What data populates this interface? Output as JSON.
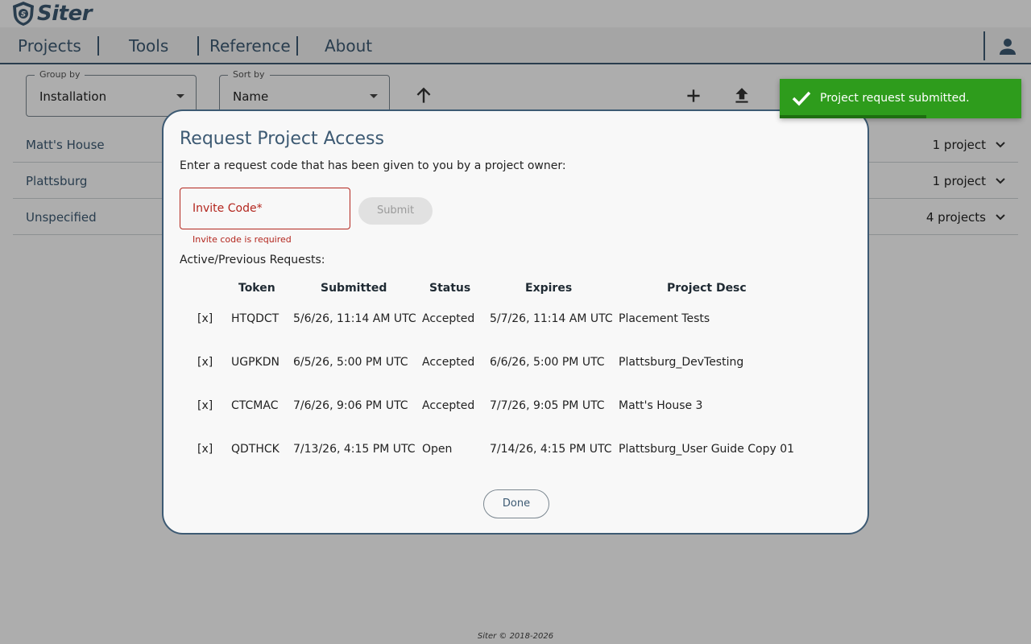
{
  "app": {
    "name": "Siter"
  },
  "nav": {
    "items": [
      {
        "label": "Projects"
      },
      {
        "label": "Tools"
      },
      {
        "label": "Reference"
      },
      {
        "label": "About"
      }
    ]
  },
  "controls": {
    "group_by": {
      "label": "Group by",
      "value": "Installation"
    },
    "sort_by": {
      "label": "Sort by",
      "value": "Name"
    }
  },
  "groups": [
    {
      "name": "Matt's House",
      "count": "1 project"
    },
    {
      "name": "Plattsburg",
      "count": "1 project"
    },
    {
      "name": "Unspecified",
      "count": "4 projects"
    }
  ],
  "footer": {
    "text": "Siter © 2018-2026"
  },
  "dialog": {
    "title": "Request Project Access",
    "subtitle": "Enter a request code that has been given to you by a project owner:",
    "invite_label": "Invite Code*",
    "invite_value": "",
    "invite_error": "Invite code is required",
    "submit_label": "Submit",
    "requests_label": "Active/Previous Requests:",
    "columns": {
      "token": "Token",
      "submitted": "Submitted",
      "status": "Status",
      "expires": "Expires",
      "desc": "Project Desc"
    },
    "rows": [
      {
        "del": "[x]",
        "token": "HTQDCT",
        "submitted": "5/6/26, 11:14 AM UTC",
        "status": "Accepted",
        "expires": "5/7/26, 11:14 AM UTC",
        "desc": "Placement Tests"
      },
      {
        "del": "[x]",
        "token": "UGPKDN",
        "submitted": "6/5/26, 5:00 PM UTC",
        "status": "Accepted",
        "expires": "6/6/26, 5:00 PM UTC",
        "desc": "Plattsburg_DevTesting"
      },
      {
        "del": "[x]",
        "token": "CTCMAC",
        "submitted": "7/6/26, 9:06 PM UTC",
        "status": "Accepted",
        "expires": "7/7/26, 9:05 PM UTC",
        "desc": "Matt's House 3"
      },
      {
        "del": "[x]",
        "token": "QDTHCK",
        "submitted": "7/13/26, 4:15 PM UTC",
        "status": "Open",
        "expires": "7/14/26, 4:15 PM UTC",
        "desc": "Plattsburg_User Guide Copy 01"
      }
    ],
    "done_label": "Done"
  },
  "toast": {
    "message": "Project request submitted.",
    "color": "#2e9c1c"
  },
  "colors": {
    "brand": "#3d5a73",
    "error": "#b3261e",
    "success": "#2e9c1c"
  }
}
